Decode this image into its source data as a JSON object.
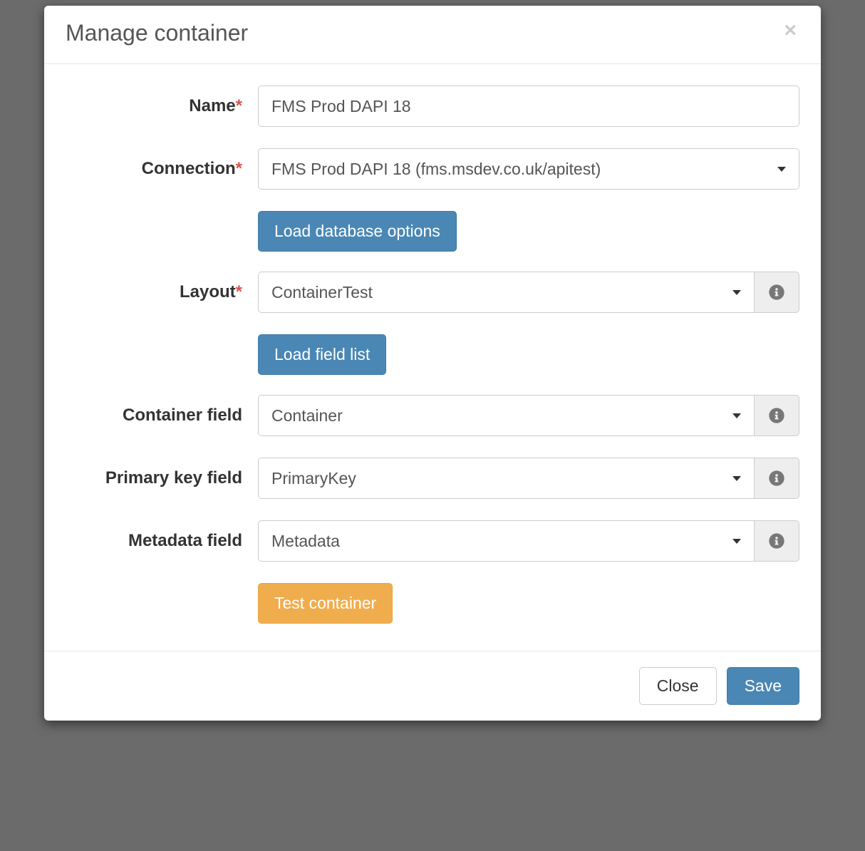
{
  "modal": {
    "title": "Manage container",
    "close_symbol": "×"
  },
  "fields": {
    "name": {
      "label": "Name",
      "value": "FMS Prod DAPI 18"
    },
    "connection": {
      "label": "Connection",
      "value": "FMS Prod DAPI 18 (fms.msdev.co.uk/apitest)"
    },
    "layout": {
      "label": "Layout",
      "value": "ContainerTest"
    },
    "container_field": {
      "label": "Container field",
      "value": "Container"
    },
    "primary_key_field": {
      "label": "Primary key field",
      "value": "PrimaryKey"
    },
    "metadata_field": {
      "label": "Metadata field",
      "value": "Metadata"
    }
  },
  "buttons": {
    "load_db_options": "Load database options",
    "load_field_list": "Load field list",
    "test_container": "Test container",
    "close": "Close",
    "save": "Save"
  },
  "required_marker": "*"
}
